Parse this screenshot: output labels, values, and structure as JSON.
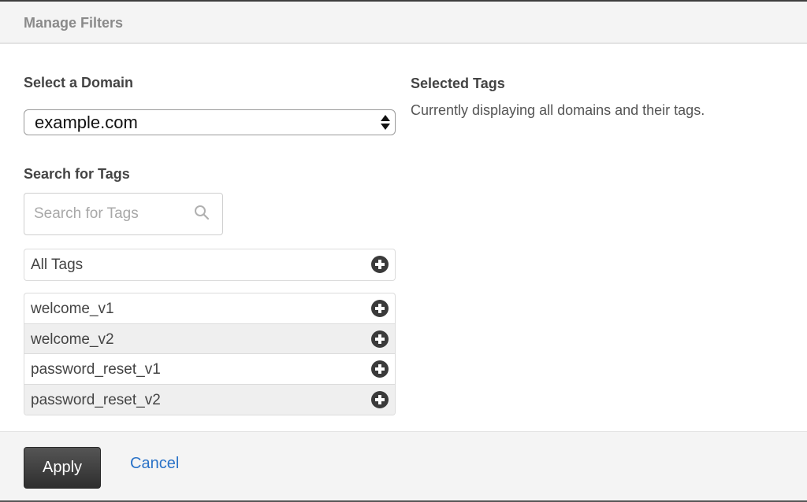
{
  "header": {
    "title": "Manage Filters"
  },
  "domain": {
    "label": "Select a Domain",
    "selected": "example.com"
  },
  "search": {
    "label": "Search for Tags",
    "placeholder": "Search for Tags",
    "value": "",
    "icon": "search-icon"
  },
  "all_tags": {
    "label": "All Tags",
    "icon": "plus-circle-icon"
  },
  "tags": [
    {
      "label": "welcome_v1",
      "icon": "plus-circle-icon"
    },
    {
      "label": "welcome_v2",
      "icon": "plus-circle-icon"
    },
    {
      "label": "password_reset_v1",
      "icon": "plus-circle-icon"
    },
    {
      "label": "password_reset_v2",
      "icon": "plus-circle-icon"
    }
  ],
  "selected": {
    "label": "Selected Tags",
    "description": "Currently displaying all domains and their tags."
  },
  "footer": {
    "apply_label": "Apply",
    "cancel_label": "Cancel"
  },
  "colors": {
    "link": "#2a72c7",
    "primary_button": "#3a3a3a"
  }
}
